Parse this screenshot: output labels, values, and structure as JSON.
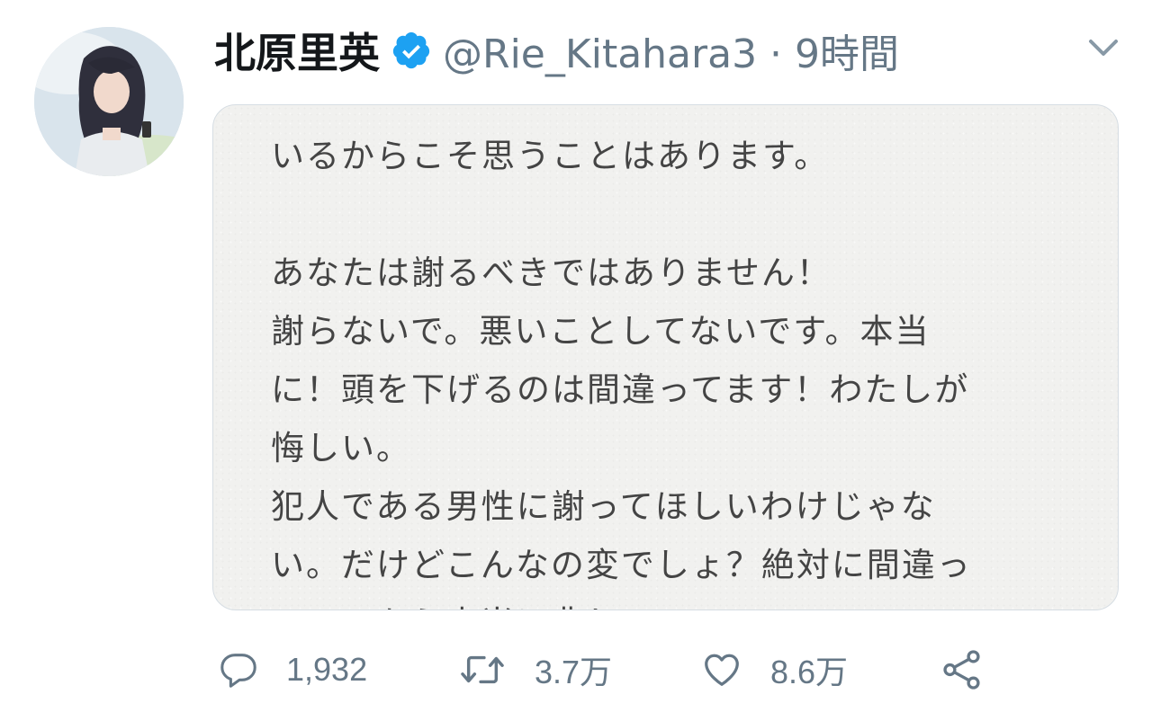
{
  "tweet": {
    "display_name": "北原里英",
    "handle_time": "@Rie_Kitahara3 · 9時間",
    "image_text": [
      "いるからこそ思うことはあります。",
      "",
      "あなたは謝るべきではありません！",
      "謝らないで。悪いことしてないです。本当",
      "に！頭を下げるのは間違ってます！わたしが",
      "悔しい。",
      "犯人である男性に謝ってほしいわけじゃな",
      "い。だけどこんなの変でしょ？絶対に間違っ",
      "てる。もう本当に悲しい"
    ]
  },
  "actions": {
    "reply_count": "1,932",
    "retweet_count": "3.7万",
    "like_count": "8.6万"
  },
  "icons": {
    "verified": "verified-badge-icon",
    "caret": "chevron-down-icon",
    "reply": "reply-icon",
    "retweet": "retweet-icon",
    "like": "heart-icon",
    "share": "share-icon"
  },
  "colors": {
    "verified": "#1da1f2",
    "secondary_text": "#657786",
    "primary_text": "#14171a"
  }
}
